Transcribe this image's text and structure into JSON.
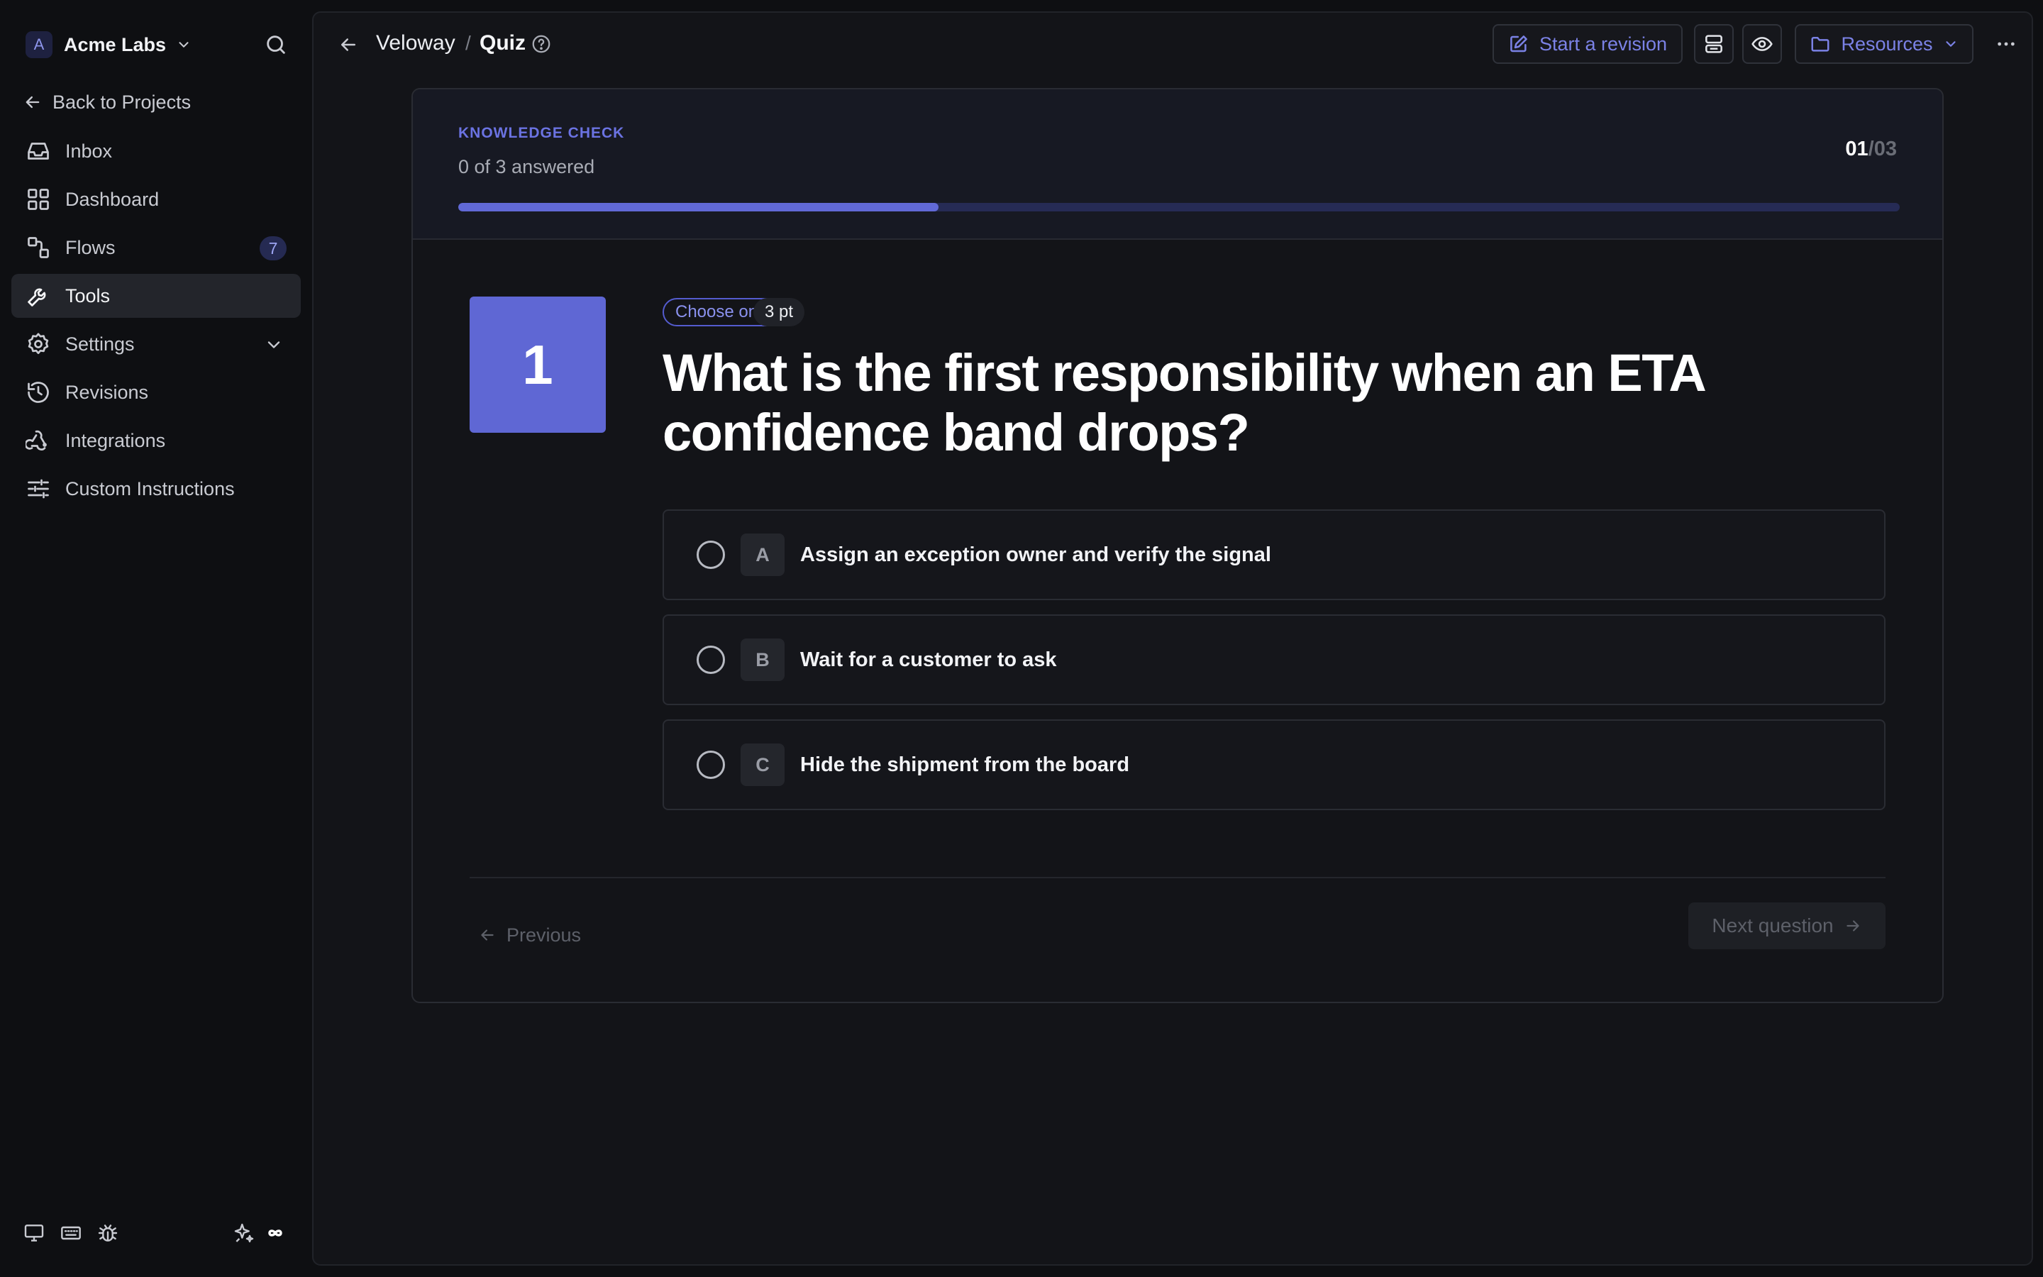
{
  "workspace": {
    "avatar_letter": "A",
    "name": "Acme Labs"
  },
  "sidebar": {
    "back_label": "Back to Projects",
    "items": [
      {
        "label": "Inbox",
        "icon": "inbox-icon"
      },
      {
        "label": "Dashboard",
        "icon": "grid-icon"
      },
      {
        "label": "Flows",
        "icon": "flows-icon",
        "badge": "7"
      },
      {
        "label": "Tools",
        "icon": "wrench-icon",
        "active": true
      },
      {
        "label": "Settings",
        "icon": "gear-icon",
        "expandable": true
      },
      {
        "label": "Revisions",
        "icon": "history-icon"
      },
      {
        "label": "Integrations",
        "icon": "webhook-icon"
      },
      {
        "label": "Custom Instructions",
        "icon": "sliders-icon"
      }
    ],
    "footer_icons": [
      "monitor-icon",
      "keyboard-icon",
      "bug-icon",
      "sparkles-icon",
      "infinity-icon"
    ]
  },
  "header": {
    "project": "Veloway",
    "separator": "/",
    "page": "Quiz",
    "revision_label": "Start a revision",
    "resources_label": "Resources"
  },
  "quiz": {
    "section_label": "KNOWLEDGE CHECK",
    "answered_text": "0 of 3 answered",
    "current": "01",
    "separator": "/",
    "total": "03",
    "progress_percent": 33.3,
    "accent_color": "#6169d6",
    "question": {
      "number": "1",
      "type_label": "Choose one",
      "points_label": "3 pt",
      "text": "What is the first responsibility when an ETA confidence band drops?",
      "options": [
        {
          "letter": "A",
          "text": "Assign an exception owner and verify the signal"
        },
        {
          "letter": "B",
          "text": "Wait for a customer to ask"
        },
        {
          "letter": "C",
          "text": "Hide the shipment from the board"
        }
      ]
    },
    "prev_label": "Previous",
    "next_label": "Next question"
  }
}
